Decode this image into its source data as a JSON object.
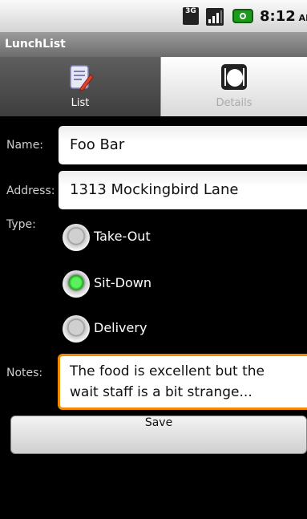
{
  "status_bar": {
    "network_label": "3G",
    "time": "8:12",
    "ampm": "AM",
    "battery_color": "#1c9a1c"
  },
  "app": {
    "title": "LunchList"
  },
  "tabs": [
    {
      "label": "List",
      "icon": "list-edit-icon",
      "selected": true
    },
    {
      "label": "Details",
      "icon": "restaurant-plate-icon",
      "selected": false
    }
  ],
  "form": {
    "name_label": "Name:",
    "name_value": "Foo Bar",
    "address_label": "Address:",
    "address_value": "1313 Mockingbird Lane",
    "type_label": "Type:",
    "types": [
      {
        "label": "Take-Out",
        "checked": false
      },
      {
        "label": "Sit-Down",
        "checked": true
      },
      {
        "label": "Delivery",
        "checked": false
      }
    ],
    "notes_label": "Notes:",
    "notes_line1": "The food is excellent but the",
    "notes_line2": "wait staff is a bit strange...",
    "save_label": "Save"
  },
  "colors": {
    "focus_border": "#f08a00",
    "radio_checked": "#1aa51a"
  }
}
